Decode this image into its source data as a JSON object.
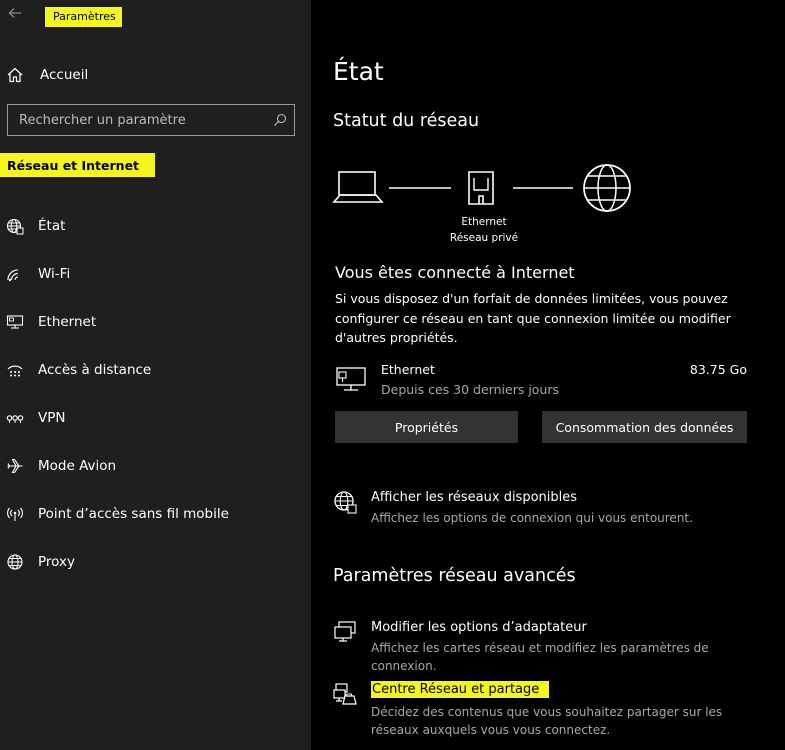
{
  "app": {
    "title": "Paramètres"
  },
  "sidebar": {
    "home": "Accueil",
    "search_placeholder": "Rechercher un paramètre",
    "section": "Réseau et Internet",
    "items": [
      {
        "label": "État",
        "icon": "globe-status-icon"
      },
      {
        "label": "Wi-Fi",
        "icon": "wifi-icon"
      },
      {
        "label": "Ethernet",
        "icon": "ethernet-icon"
      },
      {
        "label": "Accès à distance",
        "icon": "dialup-icon"
      },
      {
        "label": "VPN",
        "icon": "vpn-icon"
      },
      {
        "label": "Mode Avion",
        "icon": "airplane-icon"
      },
      {
        "label": "Point d’accès sans fil mobile",
        "icon": "hotspot-icon"
      },
      {
        "label": "Proxy",
        "icon": "globe-icon"
      }
    ]
  },
  "main": {
    "title": "État",
    "status_heading": "Statut du réseau",
    "diagram": {
      "adapter": "Ethernet",
      "network": "Réseau privé"
    },
    "connected_heading": "Vous êtes connecté à Internet",
    "connected_desc": "Si vous disposez d'un forfait de données limitées, vous pouvez configurer ce réseau en tant que connexion limitée ou modifier d'autres propriétés.",
    "connection": {
      "name": "Ethernet",
      "period": "Depuis ces 30 derniers jours",
      "usage": "83.75 Go"
    },
    "buttons": {
      "properties": "Propriétés",
      "data_usage": "Consommation des données"
    },
    "show_networks": {
      "title": "Afficher les réseaux disponibles",
      "desc": "Affichez les options de connexion qui vous entourent."
    },
    "advanced_heading": "Paramètres réseau avancés",
    "adapter_options": {
      "title": "Modifier les options d’adaptateur",
      "desc": "Affichez les cartes réseau et modifiez les paramètres de connexion."
    },
    "sharing_center": {
      "title": "Centre Réseau et partage",
      "desc": "Décidez des contenus que vous souhaitez partager sur les réseaux auxquels vous vous connectez."
    }
  },
  "colors": {
    "highlight": "#f5f71c",
    "sidebar_bg": "#1f1f1f",
    "main_bg": "#000000",
    "button_bg": "#333333"
  }
}
